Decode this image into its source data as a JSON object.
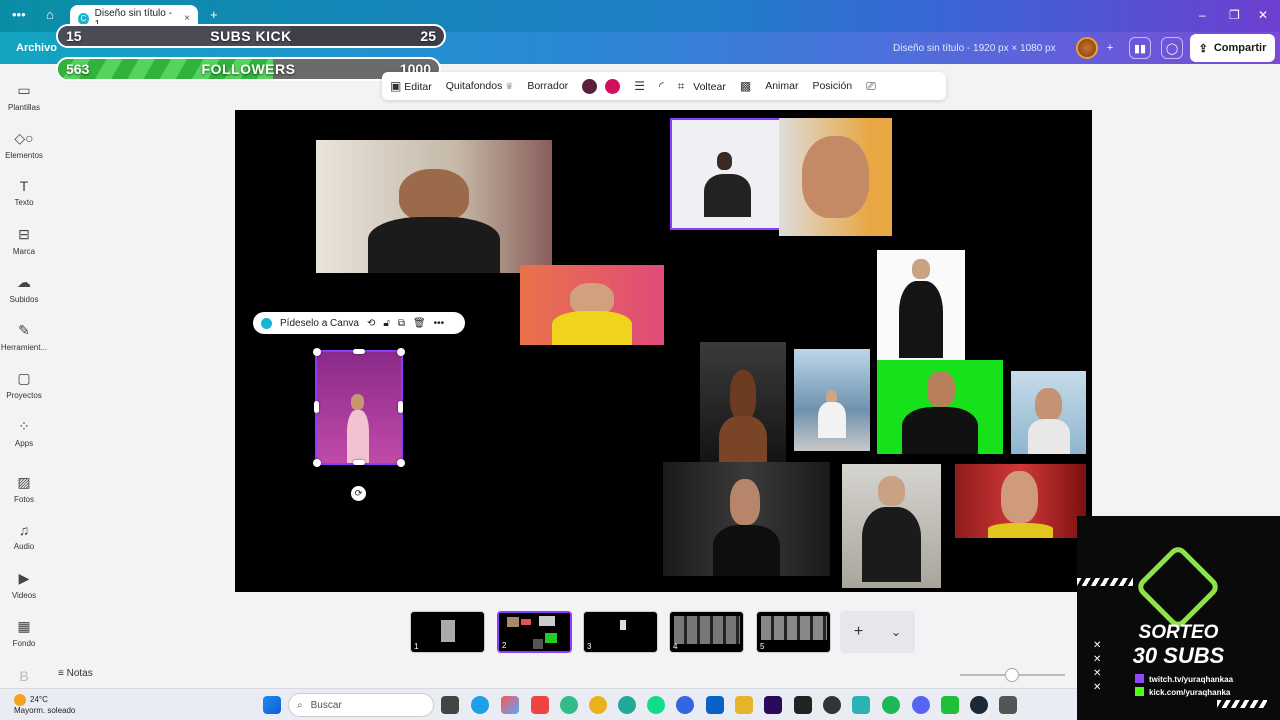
{
  "browser": {
    "tab_title": "Diseño sin título - 1...",
    "tab_close": "×",
    "new_tab": "+",
    "menu_dots": "•••",
    "home": "⌂",
    "minimize": "–",
    "restore": "❐",
    "close": "✕"
  },
  "header": {
    "archivo": "Archivo",
    "doc_title": "Diseño sin título - 1920 px × 1080 px",
    "add_btn": "+",
    "share": "Compartir"
  },
  "overlay": {
    "subs": {
      "current": "15",
      "label": "SUBS KICK",
      "goal": "25",
      "fill_fraction": 0.6
    },
    "followers": {
      "current": "563",
      "label": "FOLLOWERS",
      "goal": "1000",
      "fill_fraction": 0.563
    }
  },
  "sidebar": {
    "items": [
      {
        "label": "Plantillas",
        "icon": "templates-icon"
      },
      {
        "label": "Elementos",
        "icon": "elements-icon"
      },
      {
        "label": "Texto",
        "icon": "text-icon"
      },
      {
        "label": "Marca",
        "icon": "brand-icon"
      },
      {
        "label": "Subidos",
        "icon": "uploads-icon"
      },
      {
        "label": "Herramient...",
        "icon": "tools-icon"
      },
      {
        "label": "Proyectos",
        "icon": "projects-icon"
      },
      {
        "label": "Apps",
        "icon": "apps-icon"
      },
      {
        "label": "Fotos",
        "icon": "photos-icon"
      },
      {
        "label": "Audio",
        "icon": "audio-icon"
      },
      {
        "label": "Videos",
        "icon": "videos-icon"
      },
      {
        "label": "Fondo",
        "icon": "background-icon"
      }
    ]
  },
  "toolbar": {
    "edit": "Editar",
    "bg_remover": "Quitafondos",
    "eraser": "Borrador",
    "flip": "Voltear",
    "animate": "Animar",
    "position": "Posición",
    "colors": [
      "#5a1f3a",
      "#d0105c"
    ]
  },
  "context_menu": {
    "ask_canva": "Pídeselo a Canva",
    "more": "•••"
  },
  "pages": {
    "thumbs": [
      "1",
      "2",
      "3",
      "4",
      "5"
    ],
    "add": "+",
    "expand": "⌄"
  },
  "footer": {
    "notes": "Notas"
  },
  "taskbar": {
    "temp": "24°C",
    "weather": "Mayorm. soleado",
    "search_placeholder": "Buscar"
  },
  "sorteo": {
    "line1": "SORTEO",
    "line2": "30 SUBS",
    "twitch": "twitch.tv/yuraqhankaa",
    "kick": "kick.com/yuraqhanka"
  }
}
